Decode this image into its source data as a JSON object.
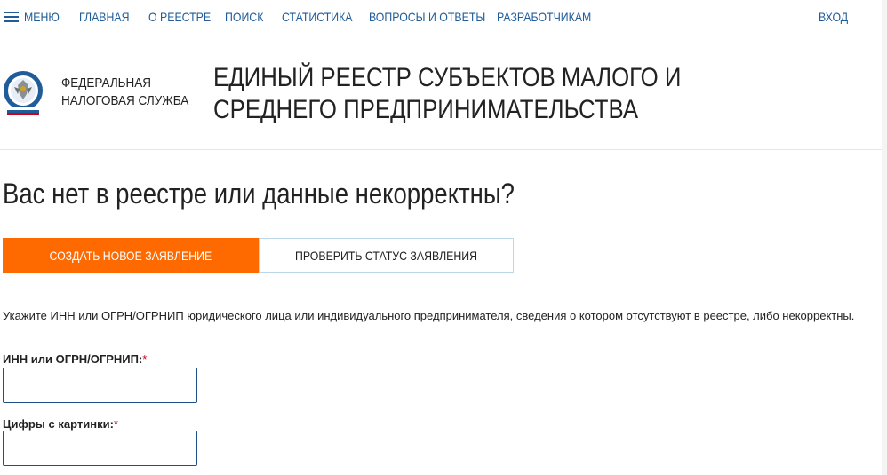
{
  "nav": {
    "menu_label": "МЕНЮ",
    "items": [
      "ГЛАВНАЯ",
      "О РЕЕСТРЕ",
      "ПОИСК",
      "СТАТИСТИКА",
      "ВОПРОСЫ И ОТВЕТЫ",
      "РАЗРАБОТЧИКАМ"
    ],
    "login_label": "ВХОД",
    "color": "#1f5c99"
  },
  "header": {
    "org_name_line1": "ФЕДЕРАЛЬНАЯ",
    "org_name_line2": "НАЛОГОВАЯ СЛУЖБА",
    "emblem_icon": "fns-emblem-icon",
    "site_title": "ЕДИНЫЙ РЕЕСТР СУБЪЕКТОВ МАЛОГО И СРЕДНЕГО ПРЕДПРИНИМАТЕЛЬСТВА"
  },
  "page": {
    "heading": "Вас нет в реестре или данные некорректны?",
    "tabs": [
      {
        "label": "СОЗДАТЬ НОВОЕ ЗАЯВЛЕНИЕ",
        "active": true
      },
      {
        "label": "ПРОВЕРИТЬ СТАТУС ЗАЯВЛЕНИЯ",
        "active": false
      }
    ],
    "accent_color": "#ff6a00"
  },
  "form": {
    "instructions": "Укажите ИНН или ОГРН/ОГРНИП юридического лица или индивидуального предпринимателя, сведения о котором отсутствуют в реестре, либо некорректны.",
    "inn_label": "ИНН или ОГРН/ОГРНИП:",
    "inn_value": "",
    "captcha_label": "Цифры с картинки:",
    "captcha_value": "",
    "required_mark": "*"
  }
}
